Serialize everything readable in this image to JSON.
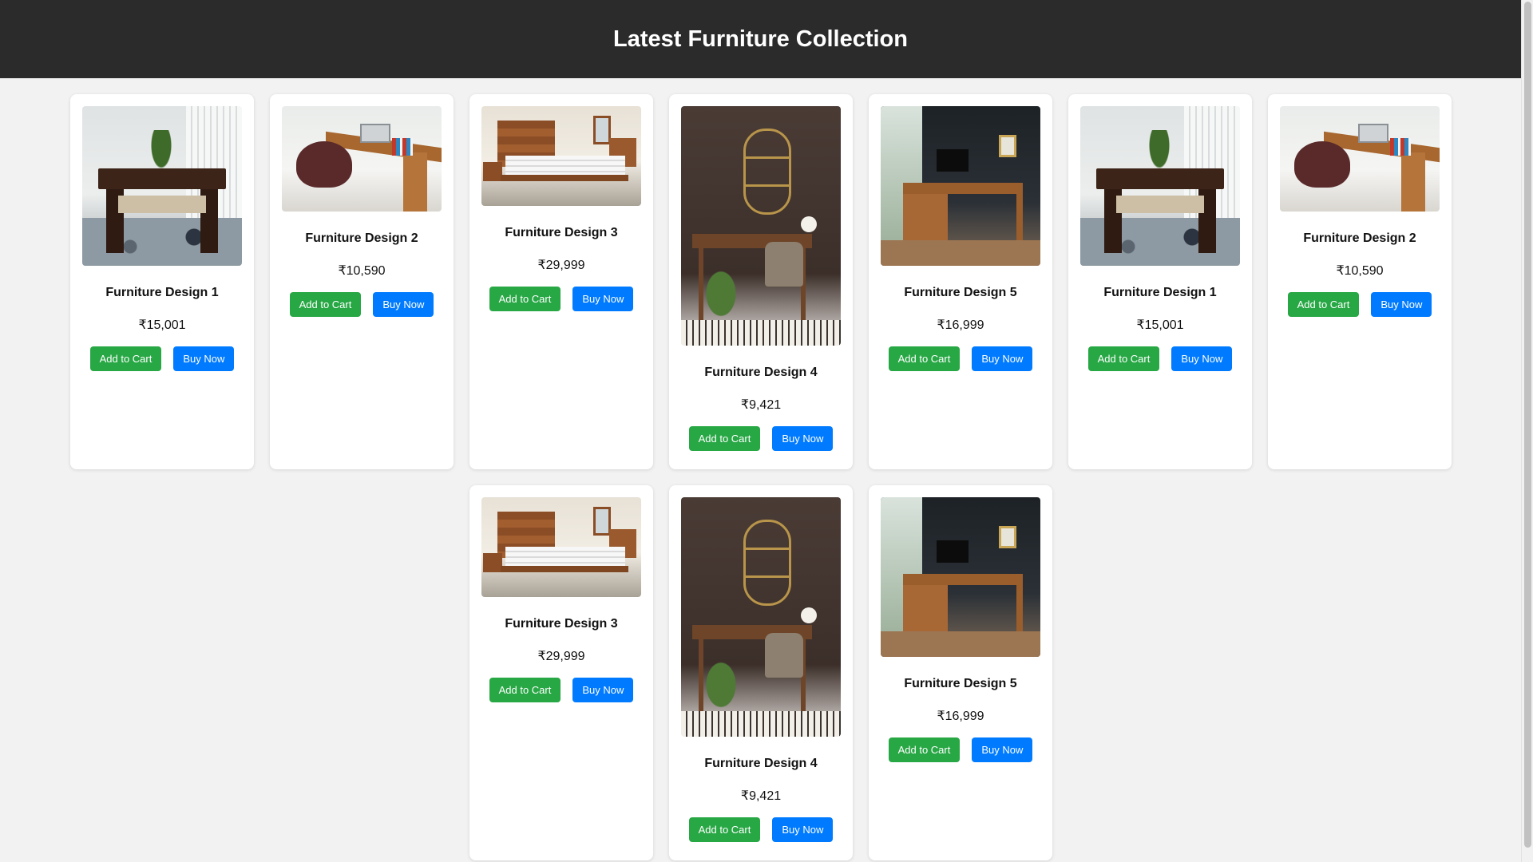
{
  "header": {
    "title": "Latest Furniture Collection"
  },
  "colors": {
    "header_bg": "#2b2b2b",
    "add_to_cart": "#28a745",
    "buy_now": "#007bff"
  },
  "products": [
    {
      "name": "Furniture Design 1",
      "price": "₹15,001",
      "image": "coffee-table-image",
      "cart_label": "Add to Cart",
      "buy_label": "Buy Now"
    },
    {
      "name": "Furniture Design 2",
      "price": "₹10,590",
      "image": "wooden-desk-image",
      "cart_label": "Add to Cart",
      "buy_label": "Buy Now"
    },
    {
      "name": "Furniture Design 3",
      "price": "₹29,999",
      "image": "bed-image",
      "cart_label": "Add to Cart",
      "buy_label": "Buy Now"
    },
    {
      "name": "Furniture Design 4",
      "price": "₹9,421",
      "image": "vanity-desk-image",
      "cart_label": "Add to Cart",
      "buy_label": "Buy Now"
    },
    {
      "name": "Furniture Design 5",
      "price": "₹16,999",
      "image": "office-desk-image",
      "cart_label": "Add to Cart",
      "buy_label": "Buy Now"
    },
    {
      "name": "Furniture Design 1",
      "price": "₹15,001",
      "image": "coffee-table-image",
      "cart_label": "Add to Cart",
      "buy_label": "Buy Now"
    },
    {
      "name": "Furniture Design 2",
      "price": "₹10,590",
      "image": "wooden-desk-image",
      "cart_label": "Add to Cart",
      "buy_label": "Buy Now"
    },
    {
      "name": "Furniture Design 3",
      "price": "₹29,999",
      "image": "bed-image",
      "cart_label": "Add to Cart",
      "buy_label": "Buy Now"
    },
    {
      "name": "Furniture Design 4",
      "price": "₹9,421",
      "image": "vanity-desk-image",
      "cart_label": "Add to Cart",
      "buy_label": "Buy Now"
    },
    {
      "name": "Furniture Design 5",
      "price": "₹16,999",
      "image": "office-desk-image",
      "cart_label": "Add to Cart",
      "buy_label": "Buy Now"
    }
  ]
}
